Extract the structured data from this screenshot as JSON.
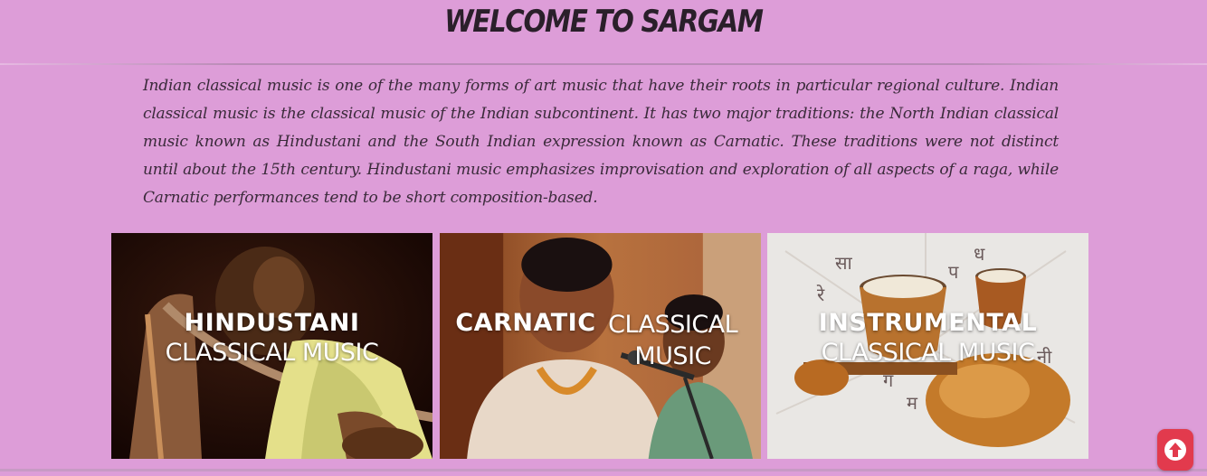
{
  "header": {
    "title": "WELCOME TO SARGAM"
  },
  "intro": {
    "text": "Indian classical music is one of the many forms of art music that have their roots in particular regional culture. Indian classical music is the classical music of the Indian subcontinent. It has two major traditions: the North Indian classical music known as Hindustani and the South Indian expression known as Carnatic. These traditions were not distinct until about the 15th century. Hindustani music emphasizes improvisation and exploration of all aspects of a raga, while Carnatic performances tend to be short composition-based."
  },
  "cards": [
    {
      "title_bold": "HINDUSTANI",
      "title_light": "CLASSICAL MUSIC",
      "icon": "sitar-player-image"
    },
    {
      "title_bold": "CARNATIC",
      "title_light": "CLASSICAL MUSIC",
      "icon": "vocalist-image"
    },
    {
      "title_bold": "INSTRUMENTAL",
      "title_light": "CLASSICAL MUSIC",
      "icon": "instruments-image"
    }
  ],
  "image_text": {
    "sa": "सा",
    "re": "रे",
    "ga": "ग",
    "ma": "म",
    "pa": "प",
    "dha": "ध",
    "ni": "नी"
  },
  "scroll_top": {
    "icon": "arrow-up-icon"
  },
  "colors": {
    "background": "#dd9dd8",
    "title": "#2a1f2a",
    "text": "#3a2a3a",
    "scroll_button": "#e23a4d"
  }
}
